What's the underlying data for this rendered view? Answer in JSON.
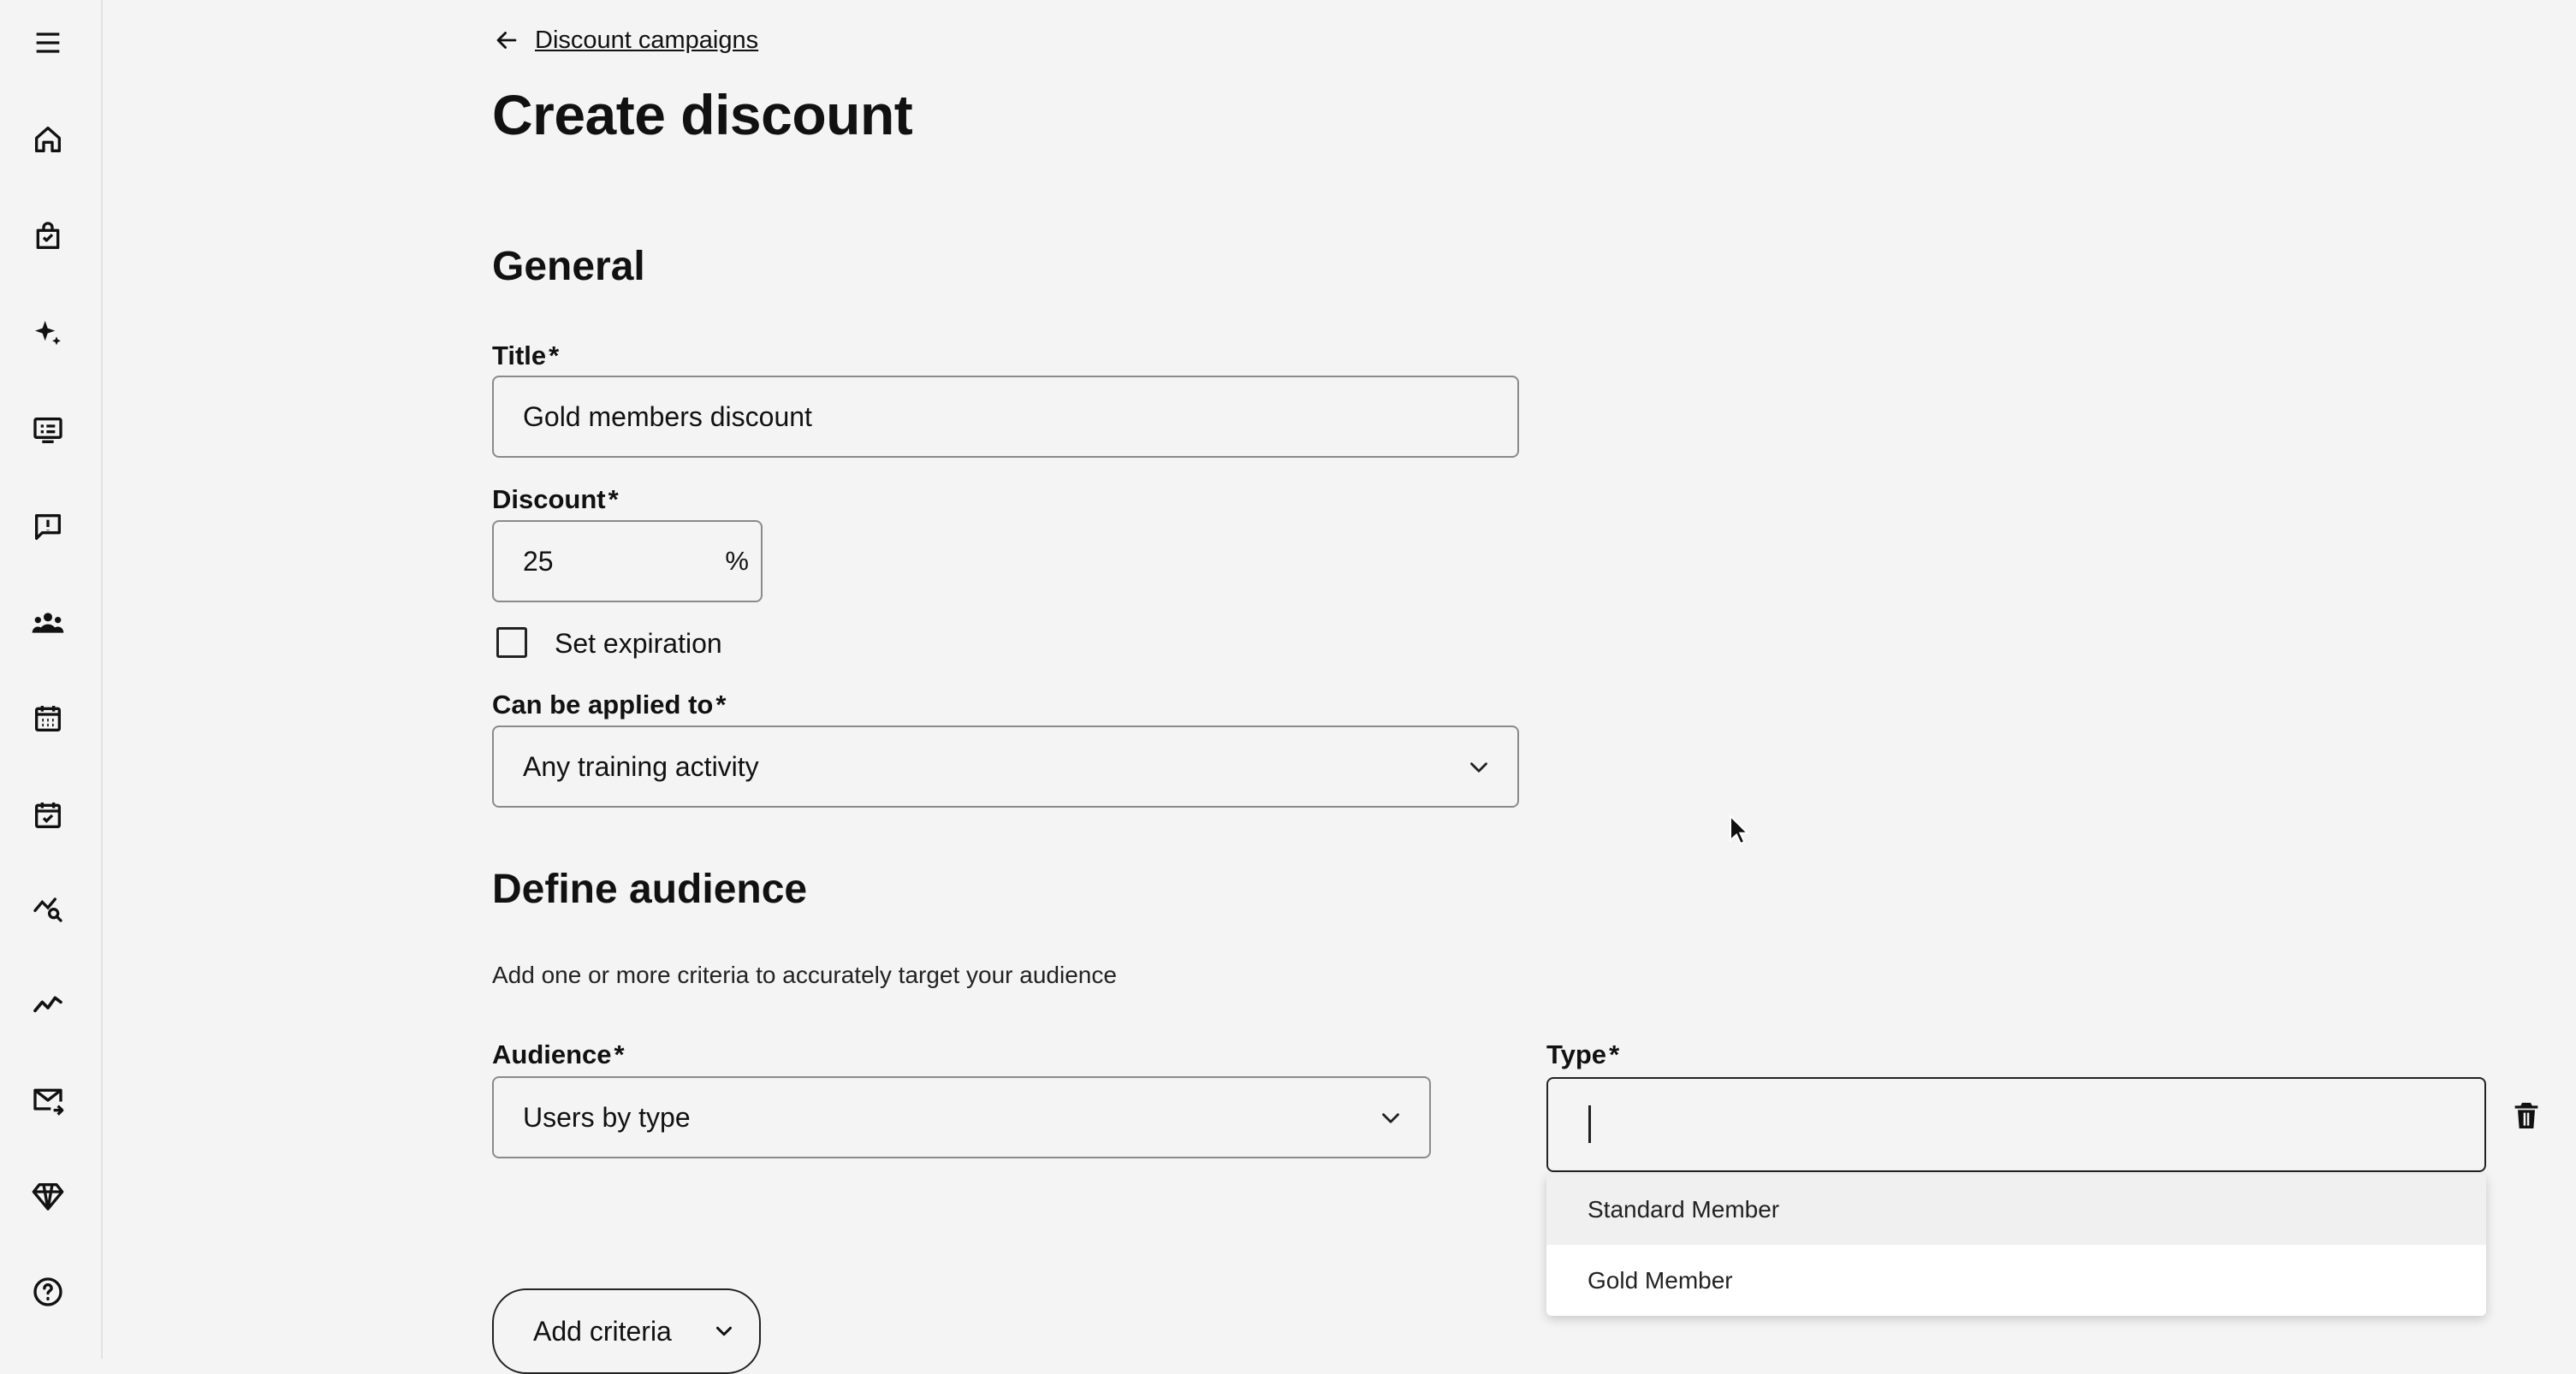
{
  "sidebar": {
    "items": [
      {
        "icon": "menu-icon"
      },
      {
        "icon": "home-icon"
      },
      {
        "icon": "shopping-bag-icon"
      },
      {
        "icon": "sparkles-icon"
      },
      {
        "icon": "list-card-icon"
      },
      {
        "icon": "message-alert-icon"
      },
      {
        "icon": "users-icon"
      },
      {
        "icon": "calendar-icon"
      },
      {
        "icon": "calendar-check-icon"
      },
      {
        "icon": "chart-search-icon"
      },
      {
        "icon": "trend-line-icon"
      },
      {
        "icon": "mail-forward-icon"
      },
      {
        "icon": "diamond-icon"
      },
      {
        "icon": "help-icon"
      }
    ]
  },
  "header": {
    "back_label": "Discount campaigns",
    "title": "Create discount"
  },
  "general": {
    "section_title": "General",
    "title_label": "Title",
    "title_value": "Gold members discount",
    "discount_label": "Discount",
    "discount_value": "25",
    "discount_suffix": "%",
    "expiration_label": "Set expiration",
    "expiration_checked": false,
    "applied_label": "Can be applied to",
    "applied_value": "Any training activity"
  },
  "audience": {
    "section_title": "Define audience",
    "help_text": "Add one or more criteria to accurately target your audience",
    "audience_label": "Audience",
    "audience_value": "Users by type",
    "type_label": "Type",
    "type_value": "",
    "type_options": [
      "Standard Member",
      "Gold Member"
    ],
    "required_mark": "*",
    "add_criteria_label": "Add criteria"
  },
  "colors": {
    "background": "#f4f4f4",
    "text": "#111111",
    "border": "#8a8a8a",
    "dropdown_hover": "#f0f0f0"
  }
}
